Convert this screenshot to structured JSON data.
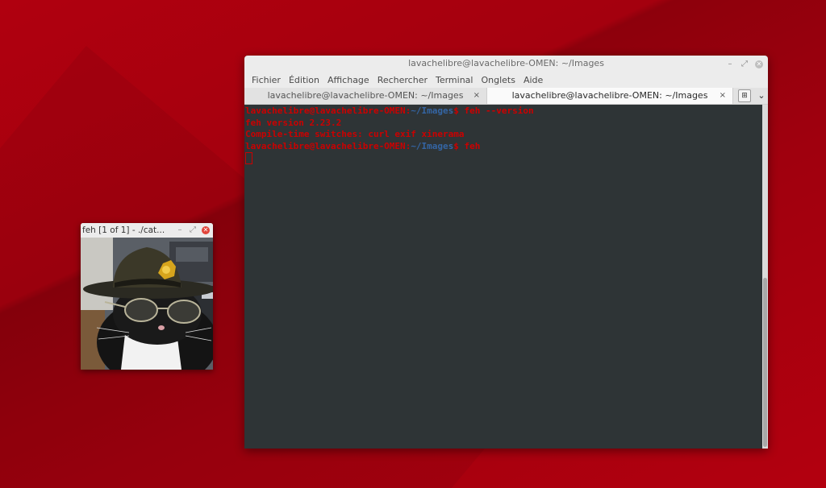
{
  "terminal": {
    "title": "lavachelibre@lavachelibre-OMEN: ~/Images",
    "window_buttons": {
      "minimize": "–",
      "maximize": "⤢",
      "close": "✕"
    },
    "menu": [
      "Fichier",
      "Édition",
      "Affichage",
      "Rechercher",
      "Terminal",
      "Onglets",
      "Aide"
    ],
    "tabs": [
      {
        "label": "lavachelibre@lavachelibre-OMEN: ~/Images",
        "close": "×",
        "active": false
      },
      {
        "label": "lavachelibre@lavachelibre-OMEN: ~/Images",
        "close": "×",
        "active": true
      }
    ],
    "tab_tools": {
      "new_tab": "⊞",
      "menu": "⌄"
    },
    "prompt_user": "lavachelibre@lavachelibre-OMEN",
    "prompt_sep": ":",
    "prompt_path": "~/Images",
    "prompt_dollar": "$",
    "lines": [
      {
        "type": "prompt",
        "command": " feh --version"
      },
      {
        "type": "output",
        "text": "feh version 2.23.2"
      },
      {
        "type": "output",
        "text": "Compile-time switches: curl exif xinerama"
      },
      {
        "type": "prompt",
        "command": " feh"
      }
    ]
  },
  "feh": {
    "title": "feh [1 of 1] - ./cat...",
    "window_buttons": {
      "minimize": "–",
      "maximize": "⤢",
      "close": "✕"
    },
    "image_subject": "cat-in-hat-with-sunglasses"
  },
  "colors": {
    "desktop": "#a8000e",
    "terminal_bg": "#2e3436",
    "prompt_text": "#cc0000",
    "path_text": "#3465a4",
    "chrome": "#ececec"
  }
}
